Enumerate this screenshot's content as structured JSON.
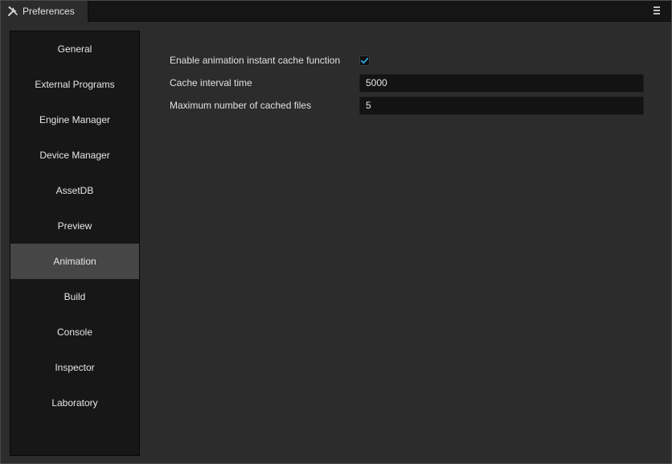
{
  "window": {
    "tab_title": "Preferences",
    "tab_icon": "tools-icon",
    "menu_icon": "hamburger-menu-icon"
  },
  "sidebar": {
    "items": [
      {
        "label": "General",
        "active": false
      },
      {
        "label": "External Programs",
        "active": false
      },
      {
        "label": "Engine Manager",
        "active": false
      },
      {
        "label": "Device Manager",
        "active": false
      },
      {
        "label": "AssetDB",
        "active": false
      },
      {
        "label": "Preview",
        "active": false
      },
      {
        "label": "Animation",
        "active": true
      },
      {
        "label": "Build",
        "active": false
      },
      {
        "label": "Console",
        "active": false
      },
      {
        "label": "Inspector",
        "active": false
      },
      {
        "label": "Laboratory",
        "active": false
      }
    ]
  },
  "animation": {
    "enable_cache_label": "Enable animation instant cache function",
    "enable_cache_checked": true,
    "cache_interval_label": "Cache interval time",
    "cache_interval_value": "5000",
    "max_cached_label": "Maximum number of cached files",
    "max_cached_value": "5"
  },
  "colors": {
    "accent": "#2fa6e0",
    "panel": "#2c2c2c",
    "sidebar": "#171717",
    "active_item": "#464646"
  }
}
